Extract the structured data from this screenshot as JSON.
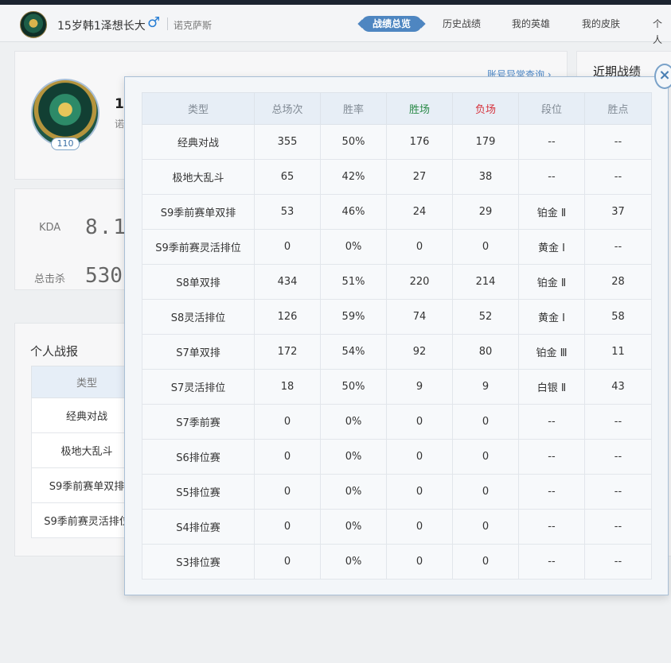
{
  "header": {
    "player_name": "15岁韩1泽想长大",
    "gender_icon": "♂",
    "region": "诺克萨斯",
    "tabs": [
      {
        "label": "战绩总览",
        "active": true
      },
      {
        "label": "历史战绩",
        "active": false
      },
      {
        "label": "我的英雄",
        "active": false
      },
      {
        "label": "我的皮肤",
        "active": false
      },
      {
        "label": "个人",
        "active": false
      }
    ]
  },
  "profile": {
    "level": "110",
    "name_peek": "1",
    "sub_peek": "诺",
    "account_link": "账号异常查询 ›"
  },
  "stats": {
    "kda_label": "KDA",
    "kda_value": "8.1",
    "kills_label": "总击杀",
    "kills_value": "530"
  },
  "report": {
    "title": "个人战报",
    "header": "类型",
    "rows": [
      "经典对战",
      "极地大乱斗",
      "S9季前赛单双排",
      "S9季前赛灵活排位"
    ]
  },
  "recent": {
    "title": "近期战绩"
  },
  "modal": {
    "close_label": "×",
    "headers": [
      "类型",
      "总场次",
      "胜率",
      "胜场",
      "负场",
      "段位",
      "胜点"
    ],
    "rows": [
      [
        "经典对战",
        "355",
        "50%",
        "176",
        "179",
        "--",
        "--"
      ],
      [
        "极地大乱斗",
        "65",
        "42%",
        "27",
        "38",
        "--",
        "--"
      ],
      [
        "S9季前赛单双排",
        "53",
        "46%",
        "24",
        "29",
        "铂金 Ⅱ",
        "37"
      ],
      [
        "S9季前赛灵活排位",
        "0",
        "0%",
        "0",
        "0",
        "黄金 Ⅰ",
        "--"
      ],
      [
        "S8单双排",
        "434",
        "51%",
        "220",
        "214",
        "铂金 Ⅱ",
        "28"
      ],
      [
        "S8灵活排位",
        "126",
        "59%",
        "74",
        "52",
        "黄金 Ⅰ",
        "58"
      ],
      [
        "S7单双排",
        "172",
        "54%",
        "92",
        "80",
        "铂金 Ⅲ",
        "11"
      ],
      [
        "S7灵活排位",
        "18",
        "50%",
        "9",
        "9",
        "白银 Ⅱ",
        "43"
      ],
      [
        "S7季前赛",
        "0",
        "0%",
        "0",
        "0",
        "--",
        "--"
      ],
      [
        "S6排位赛",
        "0",
        "0%",
        "0",
        "0",
        "--",
        "--"
      ],
      [
        "S5排位赛",
        "0",
        "0%",
        "0",
        "0",
        "--",
        "--"
      ],
      [
        "S4排位赛",
        "0",
        "0%",
        "0",
        "0",
        "--",
        "--"
      ],
      [
        "S3排位赛",
        "0",
        "0%",
        "0",
        "0",
        "--",
        "--"
      ]
    ]
  },
  "colors": {
    "accent": "#4e86c1",
    "win": "#2a8a48",
    "loss": "#d6333d"
  }
}
